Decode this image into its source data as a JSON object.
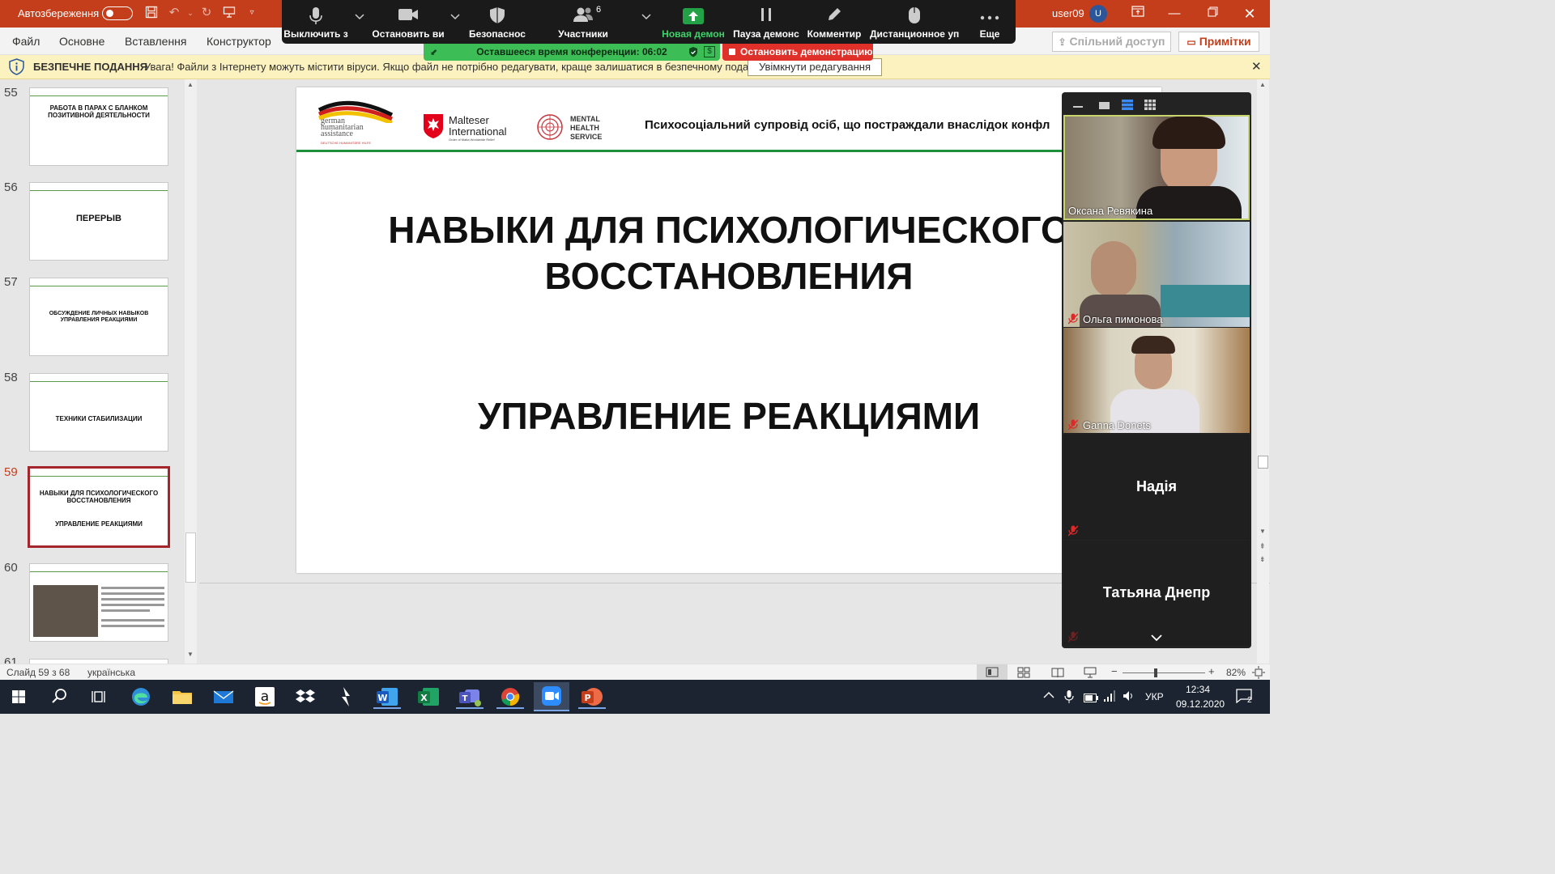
{
  "titlebar": {
    "autosave_label": "Автозбереження",
    "user": "user09",
    "avatar_initial": "U"
  },
  "ribbon": {
    "tabs": [
      "Файл",
      "Основне",
      "Вставлення",
      "Конструктор"
    ],
    "share_label": "Спільний доступ",
    "notes_label": "Примітки"
  },
  "zoom_toolbar": {
    "mute_label": "Выключить з",
    "stop_video_label": "Остановить ви",
    "security_label": "Безопаснос",
    "participants_label": "Участники",
    "participants_count": "6",
    "new_share_label": "Новая демон",
    "pause_share_label": "Пауза демонс",
    "annotate_label": "Комментир",
    "remote_control_label": "Дистанционное уп",
    "more_label": "Еще",
    "timer_text": "Оставшееся время конференции: 06:02",
    "stop_share_label": "Остановить демонстрацию"
  },
  "protected_view": {
    "label": "БЕЗПЕЧНЕ ПОДАННЯ",
    "message": "Увага! Файли з Інтернету можуть містити віруси. Якщо файл не потрібно редагувати, краще залишатися в безпечному поданні.",
    "enable_button": "Увімкнути редагування"
  },
  "thumbnails": [
    {
      "number": "55",
      "text": "РАБОТА В ПАРАХ С БЛАНКОМ ПОЗИТИВНОЙ ДЕЯТЕЛЬНОСТИ"
    },
    {
      "number": "56",
      "text": "ПЕРЕРЫВ"
    },
    {
      "number": "57",
      "text": "ОБСУЖДЕНИЕ ЛИЧНЫХ НАВЫКОВ УПРАВЛЕНИЯ РЕАКЦИЯМИ"
    },
    {
      "number": "58",
      "text": "ТЕХНИКИ СТАБИЛИЗАЦИИ"
    },
    {
      "number": "59",
      "text": "НАВЫКИ ДЛЯ ПСИХОЛОГИЧЕСКОГО ВОССТАНОВЛЕНИЯ",
      "text2": "УПРАВЛЕНИЕ РЕАКЦИЯМИ"
    },
    {
      "number": "60",
      "text": ""
    },
    {
      "number": "61",
      "text": ""
    }
  ],
  "slide": {
    "logo_german": [
      "german",
      "humanitarian",
      "assistance"
    ],
    "logo_german_sub": "DEUTSCHE HUMANITÄRE HILFE",
    "logo_malteser": [
      "Malteser",
      "International"
    ],
    "logo_malteser_sub": "Order of Malta Worldwide Relief",
    "logo_mhs": [
      "MENTAL",
      "HEALTH",
      "SERVICE"
    ],
    "header_title": "Психосоціальний супровід осіб, що постраждали внаслідок конфл",
    "title_line1": "НАВЫКИ ДЛЯ ПСИХОЛОГИЧЕСКОГО",
    "title_line2": "ВОССТАНОВЛЕНИЯ",
    "subtitle": "УПРАВЛЕНИЕ РЕАКЦИЯМИ"
  },
  "gallery": {
    "participants": [
      {
        "name": "Оксана Ревякина",
        "video": true,
        "muted": false
      },
      {
        "name": "Ольга пимонова",
        "video": true,
        "muted": true
      },
      {
        "name": "Ganna Donets",
        "video": true,
        "muted": true
      },
      {
        "name": "Надія",
        "video": false,
        "muted": true
      },
      {
        "name": "Татьяна Днепр",
        "video": false,
        "muted": true
      }
    ]
  },
  "statusbar": {
    "slide_info": "Слайд 59 з 68",
    "language": "українська",
    "zoom": "82%"
  },
  "taskbar": {
    "time": "12:34",
    "date": "09.12.2020",
    "language": "УКР",
    "notification_count": "2"
  }
}
